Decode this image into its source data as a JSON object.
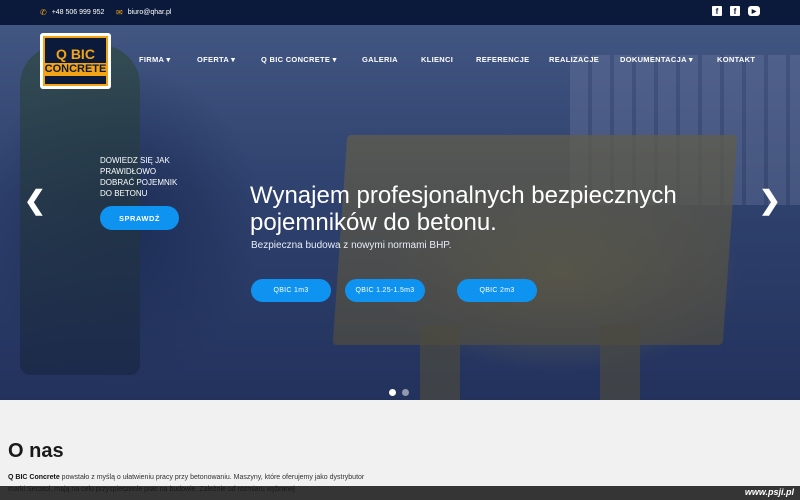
{
  "topbar": {
    "phone": "+48 506 999 952",
    "email": "biuro@qhar.pl",
    "social": [
      {
        "icon": "facebook-icon",
        "glyph": "f"
      },
      {
        "icon": "facebook-icon",
        "glyph": "f"
      },
      {
        "icon": "youtube-icon",
        "glyph": "▶"
      }
    ]
  },
  "logo": {
    "line1": "Q BIC",
    "line2": "CONCRETE"
  },
  "nav": {
    "items": [
      "FIRMA ▾",
      "OFERTA ▾",
      "Q BIC CONCRETE ▾",
      "GALERIA",
      "KLIENCI",
      "REFERENCJE",
      "REALIZACJE",
      "DOKUMENTACJA ▾",
      "KONTAKT"
    ]
  },
  "hero": {
    "promo_text": "DOWIEDZ SIĘ JAK PRAWIDŁOWO DOBRAĆ POJEMNIK DO BETONU",
    "promo_button": "SPRAWDŹ",
    "headline": "Wynajem profesjonalnych bezpiecznych pojemników do betonu.",
    "subhead": "Bezpieczna budowa z nowymi normami BHP.",
    "buttons": [
      "QBIC 1m3",
      "QBIC 1.25-1.5m3",
      "QBIC 2m3"
    ],
    "prev": "❮",
    "next": "❯",
    "active_slide": 1,
    "slide_count": 2
  },
  "about": {
    "title": "O nas",
    "brand": "Q BIC Concrete",
    "text": " powstało z myślą o ułatwieniu pracy przy betonowaniu. Maszyny, które oferujemy jako dystrybutor marki Secatol, mają na celu przyspieszenie prac na budowie. Zależnie od rozmiaru wybranej"
  },
  "watermark": "www.psji.pl",
  "colors": {
    "navy": "#0b1a3a",
    "accent": "#f3a313",
    "button": "#0f93f0"
  }
}
